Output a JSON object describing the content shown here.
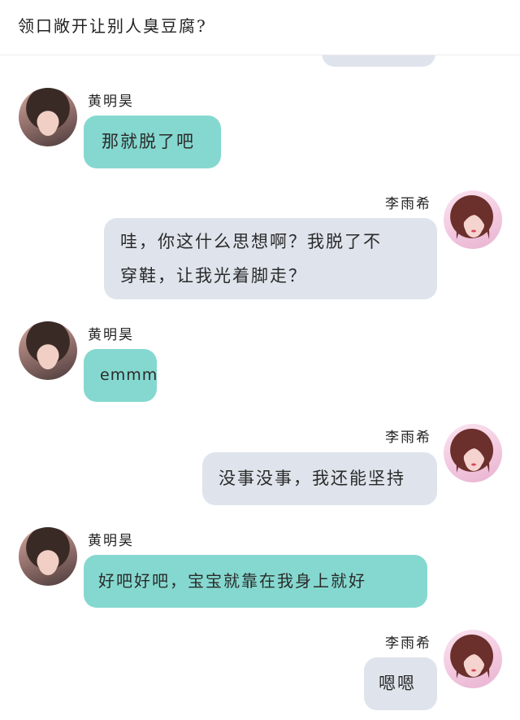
{
  "header": {
    "title": "领口敞开让别人臭豆腐?"
  },
  "messages": [
    {
      "sender": "黄明昊",
      "text": "那就脱了吧",
      "side": "left"
    },
    {
      "sender": "李雨希",
      "text_line1": "哇，你这什么思想啊？我脱了不",
      "text_line2": "穿鞋，让我光着脚走？",
      "side": "right"
    },
    {
      "sender": "黄明昊",
      "text": "emmm",
      "side": "left"
    },
    {
      "sender": "李雨希",
      "text": "没事没事，我还能坚持",
      "side": "right"
    },
    {
      "sender": "黄明昊",
      "text": "好吧好吧，宝宝就靠在我身上就好",
      "side": "left"
    },
    {
      "sender": "李雨希",
      "text": "嗯嗯",
      "side": "right"
    }
  ],
  "colors": {
    "left_bubble": "#85d8cf",
    "right_bubble": "#dfe4ec"
  }
}
